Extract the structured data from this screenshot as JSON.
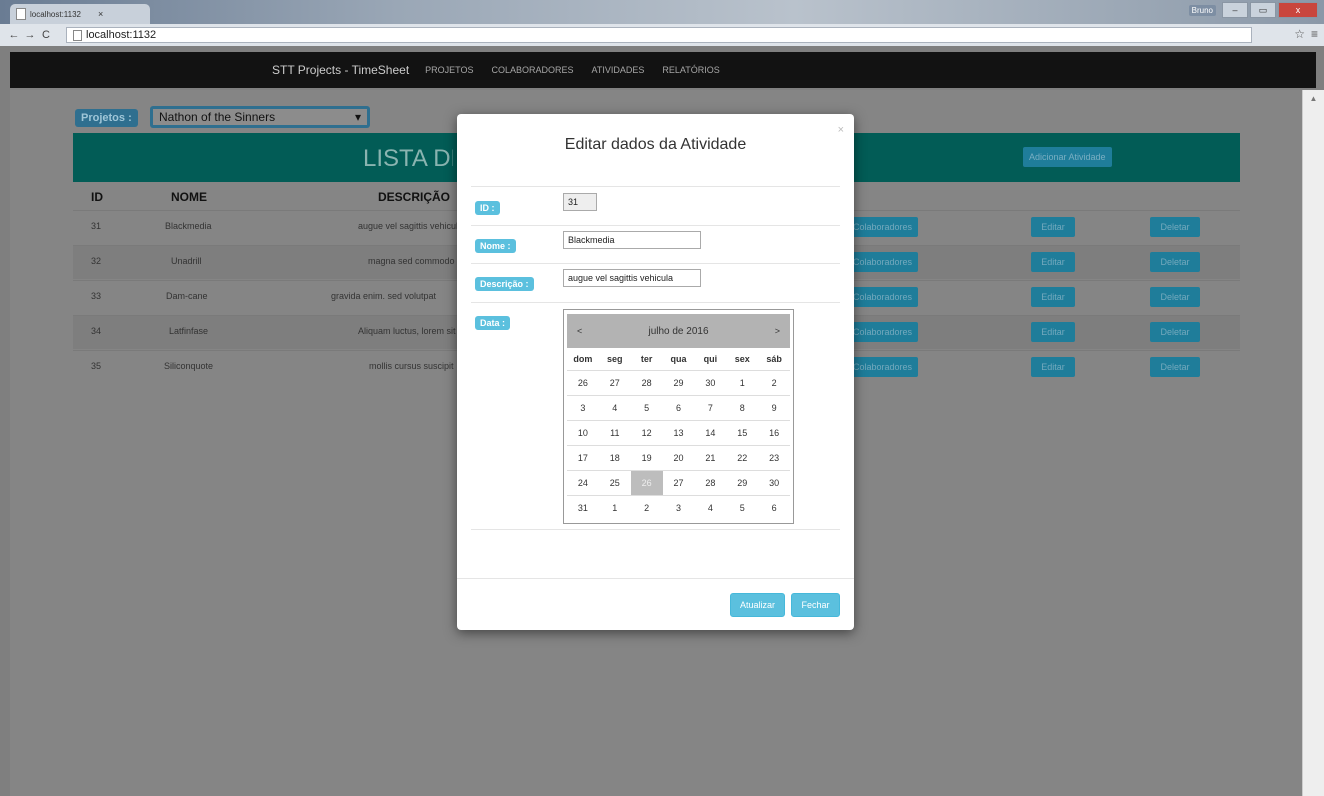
{
  "browser": {
    "tab_title": "localhost:1132",
    "tab_close": "×",
    "url": "localhost:1132",
    "user": "Bruno",
    "back": "←",
    "forward": "→",
    "reload": "C",
    "star": "☆",
    "menu": "≡",
    "win_min": "–",
    "win_max": "▭",
    "win_close": "x"
  },
  "navbar": {
    "brand": "STT Projects - TimeSheet",
    "links": [
      "PROJETOS",
      "COLABORADORES",
      "ATIVIDADES",
      "RELATÓRIOS"
    ]
  },
  "filters": {
    "projects_label": "Projetos :",
    "project_selected": "Nathon of the Sinners",
    "caret": "▾"
  },
  "banner": {
    "title": "LISTA DE ATIVIDADES",
    "add_button": "Adicionar Atividade"
  },
  "table": {
    "headers": [
      "ID",
      "NOME",
      "DESCRIÇÃO"
    ],
    "rows": [
      {
        "id": "31",
        "name": "Blackmedia",
        "desc": "augue vel sagittis vehicula",
        "colab": "Colaboradores",
        "edit": "Editar",
        "delete": "Deletar"
      },
      {
        "id": "32",
        "name": "Unadrill",
        "desc": "magna sed commodo",
        "colab": "Colaboradores",
        "edit": "Editar",
        "delete": "Deletar"
      },
      {
        "id": "33",
        "name": "Dam-cane",
        "desc": "gravida enim. sed volutpat",
        "colab": "Colaboradores",
        "edit": "Editar",
        "delete": "Deletar"
      },
      {
        "id": "34",
        "name": "Latfinfase",
        "desc": "Aliquam luctus, lorem sit",
        "colab": "Colaboradores",
        "edit": "Editar",
        "delete": "Deletar"
      },
      {
        "id": "35",
        "name": "Siliconquote",
        "desc": "mollis cursus suscipit",
        "colab": "Colaboradores",
        "edit": "Editar",
        "delete": "Deletar"
      }
    ]
  },
  "modal": {
    "title": "Editar dados da Atividade",
    "close": "×",
    "labels": {
      "id": "ID :",
      "name": "Nome :",
      "desc": "Descrição :",
      "date": "Data :"
    },
    "values": {
      "id": "31",
      "name": "Blackmedia",
      "desc": "augue vel sagittis vehicula"
    },
    "calendar": {
      "prev": "<",
      "next": ">",
      "month": "julho de 2016",
      "dows": [
        "dom",
        "seg",
        "ter",
        "qua",
        "qui",
        "sex",
        "sáb"
      ],
      "weeks": [
        [
          "26",
          "27",
          "28",
          "29",
          "30",
          "1",
          "2"
        ],
        [
          "3",
          "4",
          "5",
          "6",
          "7",
          "8",
          "9"
        ],
        [
          "10",
          "11",
          "12",
          "13",
          "14",
          "15",
          "16"
        ],
        [
          "17",
          "18",
          "19",
          "20",
          "21",
          "22",
          "23"
        ],
        [
          "24",
          "25",
          "26",
          "27",
          "28",
          "29",
          "30"
        ],
        [
          "31",
          "1",
          "2",
          "3",
          "4",
          "5",
          "6"
        ]
      ],
      "selected_day": "26"
    },
    "update_button": "Atualizar",
    "close_button": "Fechar"
  }
}
